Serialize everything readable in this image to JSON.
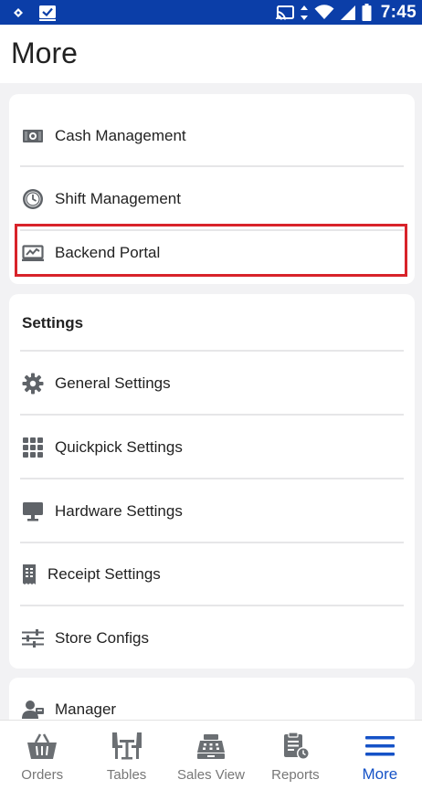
{
  "status_bar": {
    "time": "7:45",
    "icons": [
      "notification-icon",
      "download-check-icon",
      "cast-icon",
      "data-arrows-icon",
      "wifi-icon",
      "signal-icon",
      "battery-icon"
    ]
  },
  "header": {
    "title": "More"
  },
  "menu_group_1": {
    "items": [
      {
        "label": "Cash Management",
        "icon": "cash-icon"
      },
      {
        "label": "Shift Management",
        "icon": "clock-icon"
      },
      {
        "label": "Backend Portal",
        "icon": "chart-monitor-icon"
      }
    ]
  },
  "settings": {
    "title": "Settings",
    "items": [
      {
        "label": "General Settings",
        "icon": "gear-icon"
      },
      {
        "label": "Quickpick Settings",
        "icon": "grid-icon"
      },
      {
        "label": "Hardware Settings",
        "icon": "monitor-icon"
      },
      {
        "label": "Receipt Settings",
        "icon": "receipt-icon"
      },
      {
        "label": "Store Configs",
        "icon": "sliders-icon"
      }
    ]
  },
  "menu_group_3": {
    "items": [
      {
        "label": "Manager",
        "icon": "manager-icon"
      }
    ]
  },
  "bottom_nav": {
    "items": [
      {
        "label": "Orders",
        "icon": "basket-icon"
      },
      {
        "label": "Tables",
        "icon": "table-icon"
      },
      {
        "label": "Sales View",
        "icon": "register-icon"
      },
      {
        "label": "Reports",
        "icon": "report-icon"
      },
      {
        "label": "More",
        "icon": "menu-icon",
        "active": true
      }
    ]
  },
  "colors": {
    "status_bar": "#0b3ea8",
    "accent": "#1552c7",
    "highlight": "#d8232a",
    "icon_gray": "#5f6368"
  }
}
